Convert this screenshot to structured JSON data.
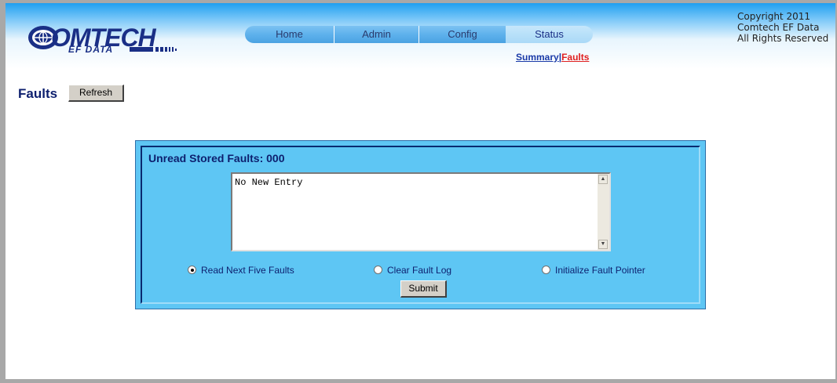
{
  "brand": {
    "logo_name": "OMTECH",
    "logo_sub": "EF DATA"
  },
  "nav": {
    "tabs": [
      {
        "label": "Home"
      },
      {
        "label": "Admin"
      },
      {
        "label": "Config"
      },
      {
        "label": "Status"
      }
    ],
    "active": "Status",
    "subnav": {
      "summary": "Summary",
      "separator": "|",
      "faults": "Faults"
    }
  },
  "copyright": {
    "line1": "Copyright 2011",
    "line2": "Comtech EF Data",
    "line3": "All Rights Reserved"
  },
  "page": {
    "title": "Faults",
    "refresh_label": "Refresh"
  },
  "panel": {
    "title": "Unread Stored Faults: 000",
    "log_text": "No New Entry",
    "options": [
      {
        "label": "Read Next Five Faults",
        "checked": true
      },
      {
        "label": "Clear Fault Log",
        "checked": false
      },
      {
        "label": "Initialize Fault Pointer",
        "checked": false
      }
    ],
    "submit_label": "Submit"
  },
  "colors": {
    "header_blue": "#1f9ff0",
    "panel_blue": "#5ec6f4",
    "title_navy": "#0d1f6e",
    "active_link_red": "#e02020"
  }
}
